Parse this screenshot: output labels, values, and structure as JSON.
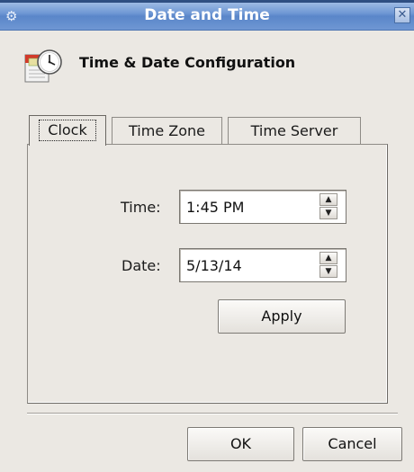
{
  "window": {
    "title": "Date and Time",
    "close_glyph": "✕",
    "app_icon_glyph": "⚙"
  },
  "header": {
    "title": "Time & Date Configuration",
    "icon": "calendar-clock-icon"
  },
  "tabs": [
    {
      "label": "Clock",
      "active": true
    },
    {
      "label": "Time Zone",
      "active": false
    },
    {
      "label": "Time Server",
      "active": false
    }
  ],
  "clock": {
    "time_label": "Time:",
    "time_value": "1:45 PM",
    "date_label": "Date:",
    "date_value": "5/13/14",
    "apply_label": "Apply",
    "spin_up_glyph": "▲",
    "spin_down_glyph": "▼"
  },
  "footer": {
    "ok_label": "OK",
    "cancel_label": "Cancel"
  },
  "colors": {
    "titlebar": "#6e97d4",
    "background": "#ebe8e3"
  }
}
